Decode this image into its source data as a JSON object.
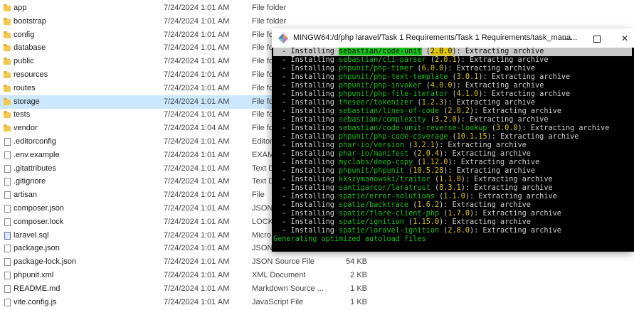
{
  "explorer": {
    "rows": [
      {
        "icon": "folder",
        "name": "app",
        "date": "7/24/2024 1:01 AM",
        "type": "File folder",
        "size": ""
      },
      {
        "icon": "folder",
        "name": "bootstrap",
        "date": "7/24/2024 1:01 AM",
        "type": "File folder",
        "size": ""
      },
      {
        "icon": "folder",
        "name": "config",
        "date": "7/24/2024 1:01 AM",
        "type": "File fo",
        "size": ""
      },
      {
        "icon": "folder",
        "name": "database",
        "date": "7/24/2024 1:01 AM",
        "type": "File fo",
        "size": ""
      },
      {
        "icon": "folder",
        "name": "public",
        "date": "7/24/2024 1:01 AM",
        "type": "File fo",
        "size": ""
      },
      {
        "icon": "folder",
        "name": "resources",
        "date": "7/24/2024 1:01 AM",
        "type": "File fo",
        "size": ""
      },
      {
        "icon": "folder",
        "name": "routes",
        "date": "7/24/2024 1:01 AM",
        "type": "File fo",
        "size": ""
      },
      {
        "icon": "folder",
        "name": "storage",
        "date": "7/24/2024 1:01 AM",
        "type": "File fo",
        "size": "",
        "selected": true
      },
      {
        "icon": "folder",
        "name": "tests",
        "date": "7/24/2024 1:01 AM",
        "type": "File fo",
        "size": ""
      },
      {
        "icon": "folder",
        "name": "vendor",
        "date": "7/24/2024 1:04 AM",
        "type": "File fo",
        "size": ""
      },
      {
        "icon": "file",
        "name": ".editorconfig",
        "date": "7/24/2024 1:01 AM",
        "type": "Editor",
        "size": ""
      },
      {
        "icon": "file",
        "name": ".env.example",
        "date": "7/24/2024 1:01 AM",
        "type": "EXAM",
        "size": ""
      },
      {
        "icon": "file",
        "name": ".gitattributes",
        "date": "7/24/2024 1:01 AM",
        "type": "Text D",
        "size": ""
      },
      {
        "icon": "file",
        "name": ".gitignore",
        "date": "7/24/2024 1:01 AM",
        "type": "Text D",
        "size": ""
      },
      {
        "icon": "file",
        "name": "artisan",
        "date": "7/24/2024 1:01 AM",
        "type": "File",
        "size": ""
      },
      {
        "icon": "file",
        "name": "composer.json",
        "date": "7/24/2024 1:01 AM",
        "type": "JSON S",
        "size": ""
      },
      {
        "icon": "file",
        "name": "composer.lock",
        "date": "7/24/2024 1:01 AM",
        "type": "LOCK",
        "size": ""
      },
      {
        "icon": "db",
        "name": "laravel.sql",
        "date": "7/24/2024 1:01 AM",
        "type": "Micro",
        "size": ""
      },
      {
        "icon": "file",
        "name": "package.json",
        "date": "7/24/2024 1:01 AM",
        "type": "JSON S",
        "size": "1 KB"
      },
      {
        "icon": "file",
        "name": "package-lock.json",
        "date": "7/24/2024 1:01 AM",
        "type": "JSON Source File",
        "size": "54 KB"
      },
      {
        "icon": "file",
        "name": "phpunit.xml",
        "date": "7/24/2024 1:01 AM",
        "type": "XML Document",
        "size": "2 KB"
      },
      {
        "icon": "file",
        "name": "README.md",
        "date": "7/24/2024 1:01 AM",
        "type": "Markdown Source ...",
        "size": "1 KB"
      },
      {
        "icon": "file",
        "name": "vite.config.js",
        "date": "7/24/2024 1:01 AM",
        "type": "JavaScript File",
        "size": "1 KB"
      }
    ]
  },
  "terminal": {
    "title": "MINGW64:/d/php laravel/Task 1 Requirements/Task 1 Requirements/task_mana...",
    "minimize_label": "—",
    "close_label": "✕",
    "app_icon": "mingw-diamond-icon",
    "colors": {
      "package": "#14c014",
      "version": "#e0c400",
      "background": "#000000"
    },
    "lines": [
      {
        "prefix": "  - Installing ",
        "pkg": "sebastian/code-unit",
        "ver": "2.0.0",
        "suffix": ": Extracting archive",
        "highlight": true
      },
      {
        "prefix": "  - Installing ",
        "pkg": "sebastian/cli-parser",
        "ver": "2.0.1",
        "suffix": ": Extracting archive"
      },
      {
        "prefix": "  - Installing ",
        "pkg": "phpunit/php-timer",
        "ver": "6.0.0",
        "suffix": ": Extracting archive"
      },
      {
        "prefix": "  - Installing ",
        "pkg": "phpunit/php-text-template",
        "ver": "3.0.1",
        "suffix": ": Extracting archive"
      },
      {
        "prefix": "  - Installing ",
        "pkg": "phpunit/php-invoker",
        "ver": "4.0.0",
        "suffix": ": Extracting archive"
      },
      {
        "prefix": "  - Installing ",
        "pkg": "phpunit/php-file-iterator",
        "ver": "4.1.0",
        "suffix": ": Extracting archive"
      },
      {
        "prefix": "  - Installing ",
        "pkg": "theseer/tokenizer",
        "ver": "1.2.3",
        "suffix": ": Extracting archive"
      },
      {
        "prefix": "  - Installing ",
        "pkg": "sebastian/lines-of-code",
        "ver": "2.0.2",
        "suffix": ": Extracting archive"
      },
      {
        "prefix": "  - Installing ",
        "pkg": "sebastian/complexity",
        "ver": "3.2.0",
        "suffix": ": Extracting archive"
      },
      {
        "prefix": "  - Installing ",
        "pkg": "sebastian/code-unit-reverse-lookup",
        "ver": "3.0.0",
        "suffix": ": Extracting archive"
      },
      {
        "prefix": "  - Installing ",
        "pkg": "phpunit/php-code-coverage",
        "ver": "10.1.15",
        "suffix": ": Extracting archive"
      },
      {
        "prefix": "  - Installing ",
        "pkg": "phar-io/version",
        "ver": "3.2.1",
        "suffix": ": Extracting archive"
      },
      {
        "prefix": "  - Installing ",
        "pkg": "phar-io/manifest",
        "ver": "2.0.4",
        "suffix": ": Extracting archive"
      },
      {
        "prefix": "  - Installing ",
        "pkg": "myclabs/deep-copy",
        "ver": "1.12.0",
        "suffix": ": Extracting archive"
      },
      {
        "prefix": "  - Installing ",
        "pkg": "phpunit/phpunit",
        "ver": "10.5.28",
        "suffix": ": Extracting archive"
      },
      {
        "prefix": "  - Installing ",
        "pkg": "kkszymanowski/traitor",
        "ver": "1.1.0",
        "suffix": ": Extracting archive"
      },
      {
        "prefix": "  - Installing ",
        "pkg": "santigarcor/laratrust",
        "ver": "8.3.1",
        "suffix": ": Extracting archive"
      },
      {
        "prefix": "  - Installing ",
        "pkg": "spatie/error-solutions",
        "ver": "1.1.0",
        "suffix": ": Extracting archive"
      },
      {
        "prefix": "  - Installing ",
        "pkg": "spatie/backtrace",
        "ver": "1.6.2",
        "suffix": ": Extracting archive"
      },
      {
        "prefix": "  - Installing ",
        "pkg": "spatie/flare-client-php",
        "ver": "1.7.0",
        "suffix": ": Extracting archive"
      },
      {
        "prefix": "  - Installing ",
        "pkg": "spatie/ignition",
        "ver": "1.15.0",
        "suffix": ": Extracting archive"
      },
      {
        "prefix": "  - Installing ",
        "pkg": "spatie/laravel-ignition",
        "ver": "2.8.0",
        "suffix": ": Extracting archive"
      }
    ],
    "final_line": "Generating optimized autoload files"
  }
}
